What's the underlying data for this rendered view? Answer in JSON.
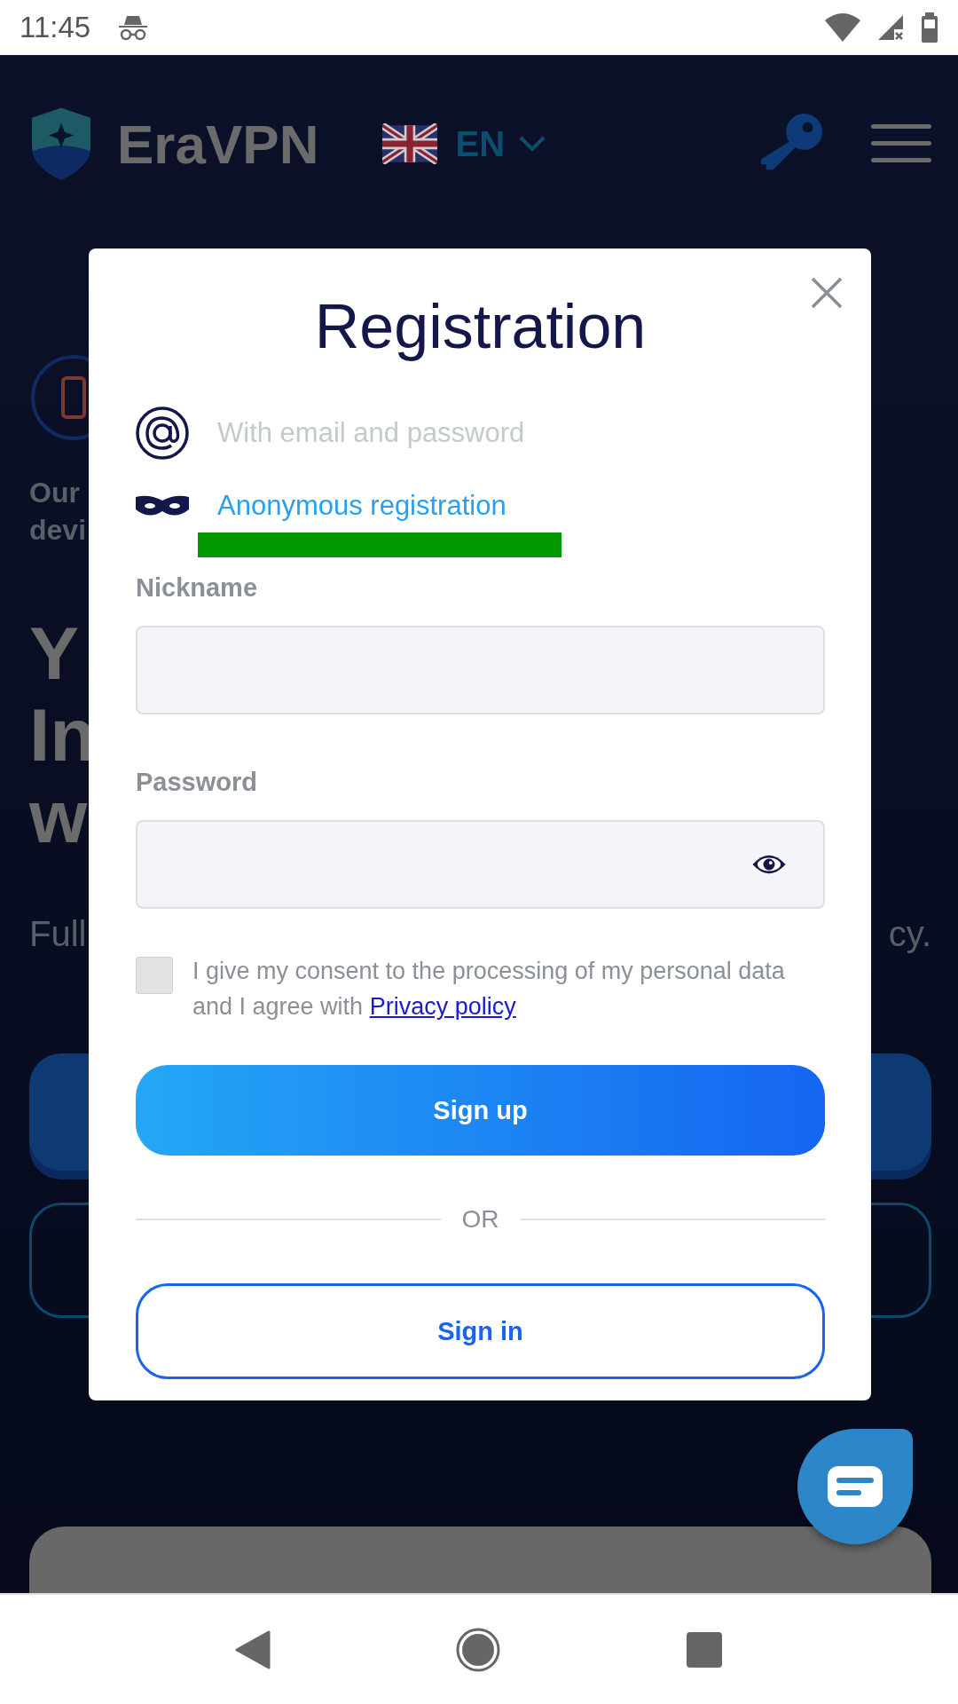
{
  "status_bar": {
    "time": "11:45"
  },
  "header": {
    "brand": "EraVPN",
    "language": "EN"
  },
  "background": {
    "feature_text": [
      "Our",
      "devi"
    ],
    "headline": [
      "Y",
      "In",
      "w"
    ],
    "subtitle_left": "Full",
    "subtitle_right": "cy."
  },
  "modal": {
    "title": "Registration",
    "methods": [
      {
        "kind": "email",
        "label": "With email and password",
        "selected": false
      },
      {
        "kind": "anonymous",
        "label": "Anonymous registration",
        "selected": true
      }
    ],
    "fields": [
      {
        "kind": "text",
        "label": "Nickname"
      },
      {
        "kind": "password",
        "label": "Password"
      }
    ],
    "consent": {
      "checked": false,
      "text": "I give my consent to the processing of my personal data and I agree with",
      "link": "Privacy policy"
    },
    "primary_button": "Sign up",
    "divider": "OR",
    "secondary_button": "Sign in"
  }
}
